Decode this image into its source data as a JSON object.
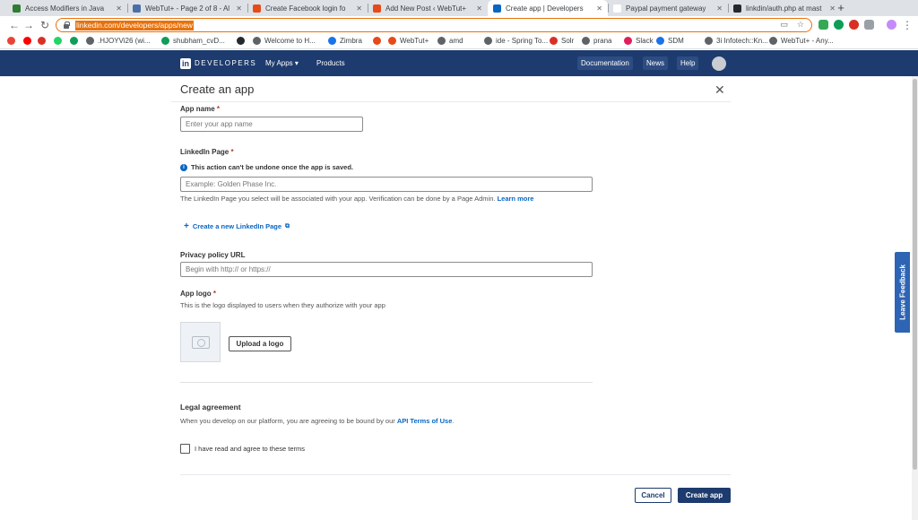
{
  "browser": {
    "tabs": [
      {
        "title": "Access Modifiers in Java",
        "color": "#2e7d32"
      },
      {
        "title": "WebTut+ - Page 2 of 8 - Al",
        "color": "#4a6fa5"
      },
      {
        "title": "Create Facebook login fo",
        "color": "#e64a19"
      },
      {
        "title": "Add New Post ‹ WebTut+",
        "color": "#e64a19"
      },
      {
        "title": "Create app | Developers",
        "color": "#0a66c2"
      },
      {
        "title": "Paypal payment gateway",
        "color": "#ffffff"
      },
      {
        "title": "linkdin/auth.php at mast",
        "color": "#24292e"
      }
    ],
    "new_tab": "+",
    "url": "linkedin.com/developers/apps/new",
    "bookmarks": [
      {
        "label": "",
        "color": "#ea4335"
      },
      {
        "label": "",
        "color": "#ff0000"
      },
      {
        "label": "",
        "color": "#d93025"
      },
      {
        "label": "",
        "color": "#25d366"
      },
      {
        "label": "",
        "color": "#0f9d58"
      },
      {
        "label": ".HJOYVi26 (wi...",
        "color": "#5f6368"
      },
      {
        "label": "shubham_cvD...",
        "color": "#0f9d58"
      },
      {
        "label": "",
        "color": "#24292e"
      },
      {
        "label": "Welcome to H...",
        "color": "#5f6368"
      },
      {
        "label": "Zimbra",
        "color": "#1a73e8"
      },
      {
        "label": "",
        "color": "#e64a19"
      },
      {
        "label": "WebTut+",
        "color": "#e64a19"
      },
      {
        "label": "amd",
        "color": "#5f6368"
      },
      {
        "label": "ide - Spring To...",
        "color": "#5f6368"
      },
      {
        "label": "Solr",
        "color": "#d93025"
      },
      {
        "label": "prana",
        "color": "#5f6368"
      },
      {
        "label": "Slack",
        "color": "#e01e5a"
      },
      {
        "label": "SDM",
        "color": "#1a73e8"
      },
      {
        "label": "3i Infotech::Kn...",
        "color": "#5f6368"
      },
      {
        "label": "WebTut+ - Any...",
        "color": "#5f6368"
      }
    ]
  },
  "header": {
    "logo": "in",
    "brand": "DEVELOPERS",
    "nav": {
      "my_apps": "My Apps ▾",
      "products": "Products"
    },
    "buttons": {
      "documentation": "Documentation",
      "news": "News",
      "help": "Help"
    }
  },
  "modal": {
    "title": "Create an app",
    "close": "✕",
    "app_name": {
      "label": "App name",
      "placeholder": "Enter your app name"
    },
    "linkedin_page": {
      "label": "LinkedIn Page",
      "warning": "This action can't be undone once the app is saved.",
      "placeholder": "Example: Golden Phase Inc.",
      "help": "The LinkedIn Page you select will be associated with your app. Verification can be done by a Page Admin.",
      "learn_more": "Learn more",
      "create_page": "Create a new LinkedIn Page"
    },
    "privacy": {
      "label": "Privacy policy URL",
      "placeholder": "Begin with http:// or https://"
    },
    "logo": {
      "label": "App logo",
      "help": "This is the logo displayed to users when they authorize with your app",
      "upload": "Upload a logo"
    },
    "legal": {
      "title": "Legal agreement",
      "text": "When you develop on our platform, you are agreeing to be bound by our",
      "link": "API Terms of Use",
      "period": ".",
      "checkbox": "I have read and agree to these terms"
    },
    "required_mark": "*",
    "cancel": "Cancel",
    "create": "Create app"
  },
  "feedback": "Leave Feedback"
}
